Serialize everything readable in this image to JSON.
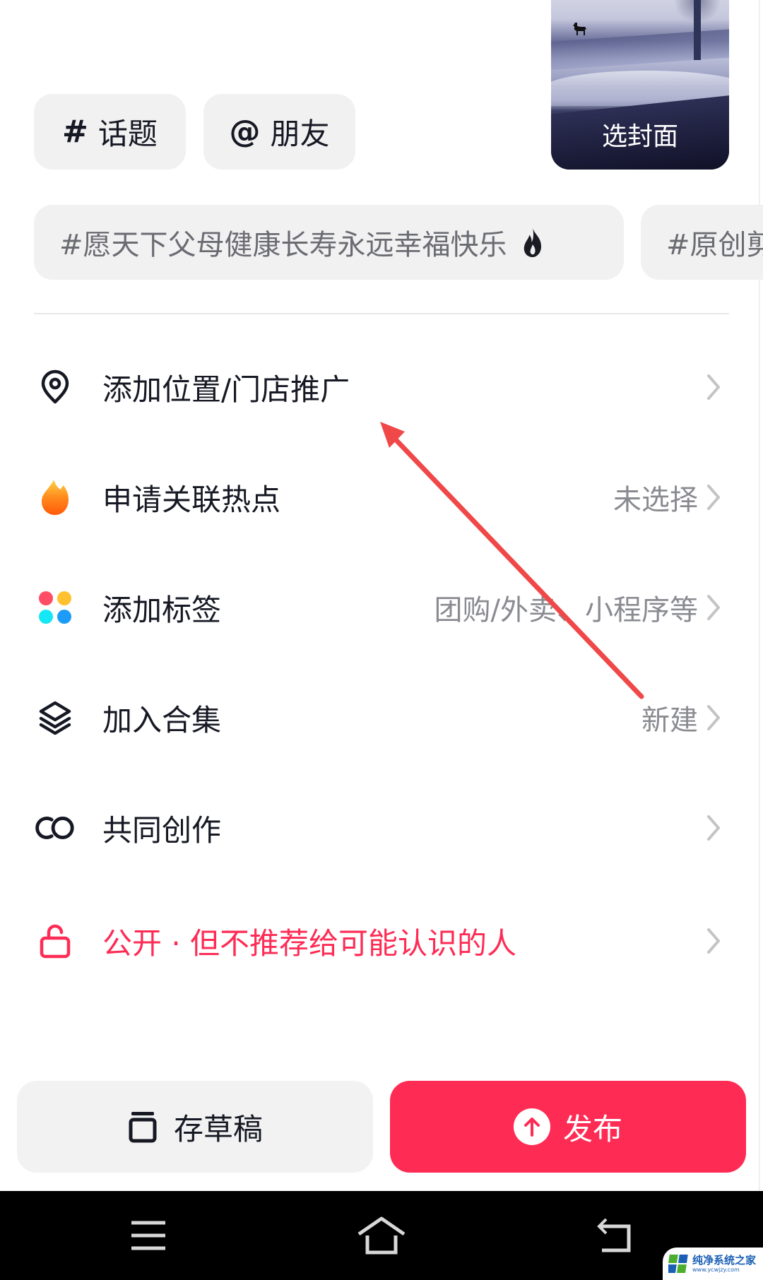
{
  "chips": {
    "topic": {
      "symbol": "#",
      "label": "话题"
    },
    "friend": {
      "symbol": "@",
      "label": "朋友"
    }
  },
  "cover": {
    "label": "选封面"
  },
  "hashtags": [
    {
      "text": "#愿天下父母健康长寿永远幸福快乐",
      "icon": "flame-icon"
    },
    {
      "text": "#原创剪"
    }
  ],
  "menu": [
    {
      "icon": "location-pin-icon",
      "label": "添加位置/门店推广",
      "value": ""
    },
    {
      "icon": "hot-flame-icon",
      "label": "申请关联热点",
      "value": "未选择"
    },
    {
      "icon": "tag-dots-icon",
      "label": "添加标签",
      "value": "团购/外卖、小程序等"
    },
    {
      "icon": "layers-icon",
      "label": "加入合集",
      "value": "新建"
    },
    {
      "icon": "co-create-icon",
      "label": "共同创作",
      "value": ""
    },
    {
      "icon": "unlock-icon",
      "label": "公开 · 但不推荐给可能认识的人",
      "value": ""
    }
  ],
  "actions": {
    "draft_label": "存草稿",
    "publish_label": "发布"
  },
  "colors": {
    "accent": "#fe2c55",
    "chip_bg": "#f1f1f2",
    "text_primary": "#161823",
    "text_secondary": "#8a8b91",
    "annotation_arrow": "#f04848"
  },
  "navbar": {
    "buttons": [
      "menu",
      "home",
      "back"
    ]
  },
  "watermark": {
    "title": "纯净系统之家",
    "url": "www.ycwjzy.com"
  }
}
